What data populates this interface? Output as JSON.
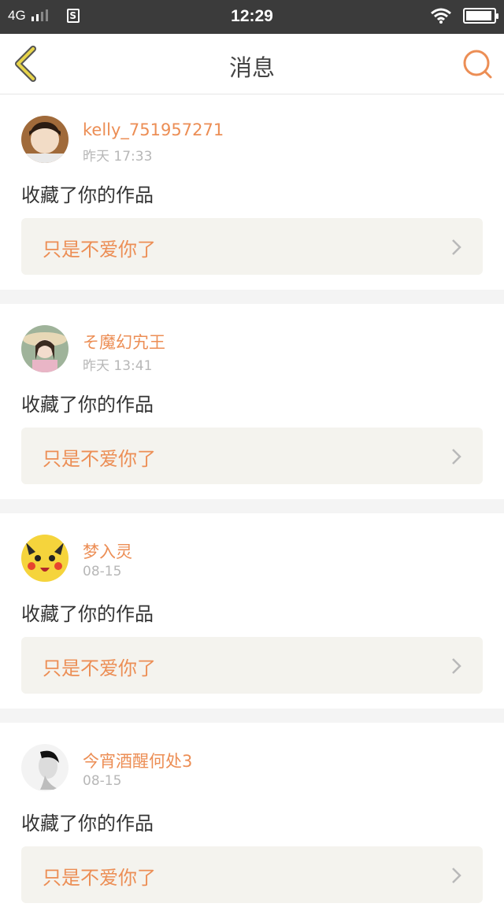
{
  "status_bar": {
    "network": "4G",
    "time": "12:29",
    "battery_level": 0.95,
    "icons": [
      "signal-icon",
      "sim-s-icon",
      "wifi-icon",
      "battery-icon"
    ]
  },
  "header": {
    "title": "消息",
    "back_icon": "chevron-left-icon",
    "search_icon": "search-icon"
  },
  "colors": {
    "accent": "#ec8e55",
    "back_icon": "#e7d44a",
    "card_bg": "#f4f3ee"
  },
  "messages": [
    {
      "user": "kelly_751957271",
      "time": "昨天 17:33",
      "action": "收藏了你的作品",
      "work": "只是不爱你了"
    },
    {
      "user": "そ魔幻宄王",
      "time": "昨天 13:41",
      "action": "收藏了你的作品",
      "work": "只是不爱你了"
    },
    {
      "user": "梦入灵",
      "time": "08-15",
      "action": "收藏了你的作品",
      "work": "只是不爱你了"
    },
    {
      "user": "今宵酒醒何处3",
      "time": "08-15",
      "action": "收藏了你的作品",
      "work": "只是不爱你了"
    }
  ]
}
